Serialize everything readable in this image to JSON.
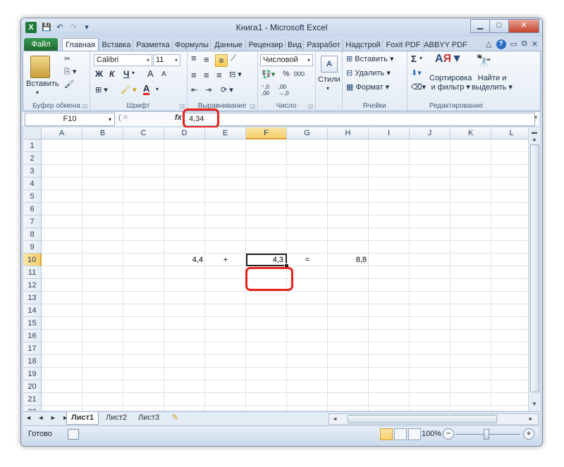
{
  "window": {
    "title": "Книга1  -  Microsoft Excel",
    "app_icon": "X",
    "controls": {
      "minimize": "▁",
      "maximize": "□",
      "close": "✕"
    }
  },
  "tabs": {
    "file": "Файл",
    "items": [
      "Главная",
      "Вставка",
      "Разметка",
      "Формулы",
      "Данные",
      "Рецензир",
      "Вид",
      "Разработ",
      "Надстрой",
      "Foxit PDF",
      "ABBYY PDF"
    ],
    "active": "Главная"
  },
  "ribbon": {
    "clipboard": {
      "paste": "Вставить",
      "label": "Буфер обмена"
    },
    "font": {
      "name": "Calibri",
      "size": "11",
      "bold": "Ж",
      "italic": "К",
      "underline": "Ч",
      "grow": "A",
      "shrink": "A",
      "font_color": "A",
      "label": "Шрифт"
    },
    "alignment": {
      "label": "Выравнивание"
    },
    "number": {
      "format": "Числовой",
      "percent": "%",
      "thousands": "000",
      "inc_decimal": "+,0 ,00",
      "dec_decimal": ",00 →,0",
      "label": "Число"
    },
    "styles": {
      "label": "Стили"
    },
    "cells": {
      "insert": "Вставить",
      "delete": "Удалить",
      "format": "Формат",
      "label": "Ячейки"
    },
    "editing": {
      "sum": "Σ",
      "sort": "Сортировка\nи фильтр",
      "sort_line1": "Сортировка",
      "sort_line2": "и фильтр",
      "find_line1": "Найти и",
      "find_line2": "выделить",
      "label": "Редактирование"
    }
  },
  "formula_bar": {
    "name_box": "F10",
    "fx": "fx",
    "value": "4,34"
  },
  "grid": {
    "columns": [
      "A",
      "B",
      "C",
      "D",
      "E",
      "F",
      "G",
      "H",
      "I",
      "J",
      "K",
      "L"
    ],
    "rows": [
      "1",
      "2",
      "3",
      "4",
      "5",
      "6",
      "7",
      "8",
      "9",
      "10",
      "11",
      "12",
      "13",
      "14",
      "15",
      "16",
      "17",
      "18",
      "19",
      "20",
      "21",
      "22"
    ],
    "selected_column": "F",
    "selected_row": "10",
    "cells": {
      "D10": "4,4",
      "E10": "+",
      "F10": "4,3",
      "G10": "=",
      "H10": "8,8"
    }
  },
  "sheets": {
    "tabs": [
      "Лист1",
      "Лист2",
      "Лист3"
    ],
    "active": "Лист1",
    "nav": "◄ ◄ ► ►"
  },
  "status": {
    "text": "Готово",
    "zoom": "100%",
    "zoom_minus": "−",
    "zoom_plus": "+"
  }
}
